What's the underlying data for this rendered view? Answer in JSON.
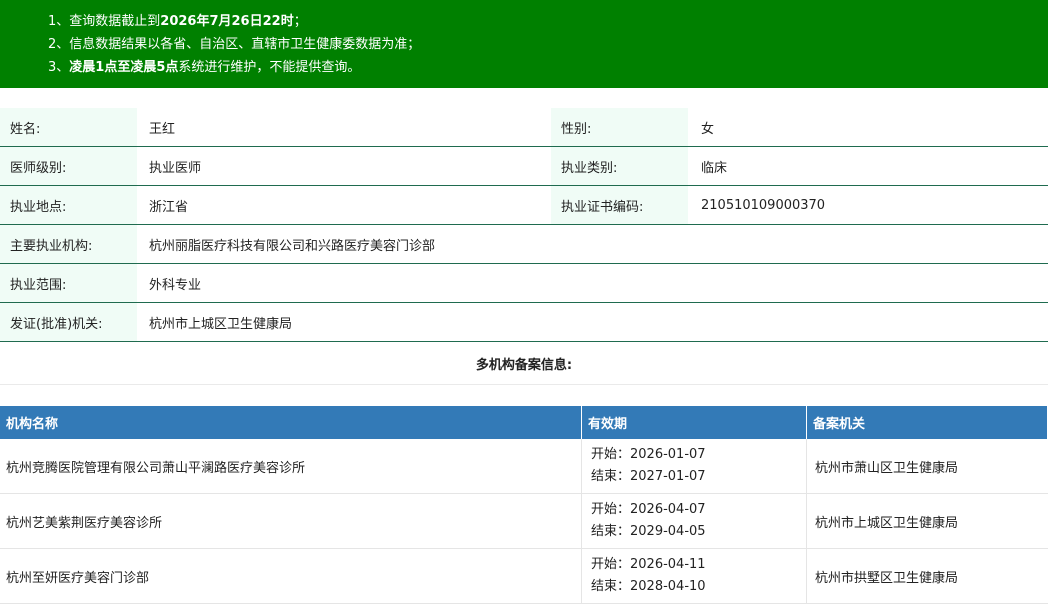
{
  "notice": {
    "line1_prefix": "1、查询数据截止到",
    "line1_bold": "2026年7月26日22时",
    "line1_suffix": "；",
    "line2": "2、信息数据结果以各省、自治区、直辖市卫生健康委数据为准；",
    "line3_prefix": "3、",
    "line3_bold": "凌晨1点至凌晨5点",
    "line3_suffix": "系统进行维护，不能提供查询。"
  },
  "doctor": {
    "name_label": "姓名:",
    "name": "王红",
    "gender_label": "性别:",
    "gender": "女",
    "level_label": "医师级别:",
    "level": "执业医师",
    "category_label": "执业类别:",
    "category": "临床",
    "location_label": "执业地点:",
    "location": "浙江省",
    "cert_label": "执业证书编码:",
    "cert": "210510109000370",
    "institution_label": "主要执业机构:",
    "institution": "杭州丽脂医疗科技有限公司和兴路医疗美容门诊部",
    "scope_label": "执业范围:",
    "scope": "外科专业",
    "issuer_label": "发证(批准)机关:",
    "issuer": "杭州市上城区卫生健康局"
  },
  "multi": {
    "title": "多机构备案信息:",
    "headers": [
      "机构名称",
      "有效期",
      "备案机关"
    ],
    "rows": [
      {
        "name": "杭州竞腾医院管理有限公司萧山平澜路医疗美容诊所",
        "start": "开始：2026-01-07",
        "end": "结束：2027-01-07",
        "agency": "杭州市萧山区卫生健康局"
      },
      {
        "name": "杭州艺美紫荆医疗美容诊所",
        "start": "开始：2026-04-07",
        "end": "结束：2029-04-05",
        "agency": "杭州市上城区卫生健康局"
      },
      {
        "name": "杭州至妍医疗美容门诊部",
        "start": "开始：2026-04-11",
        "end": "结束：2028-04-10",
        "agency": "杭州市拱墅区卫生健康局"
      }
    ]
  }
}
